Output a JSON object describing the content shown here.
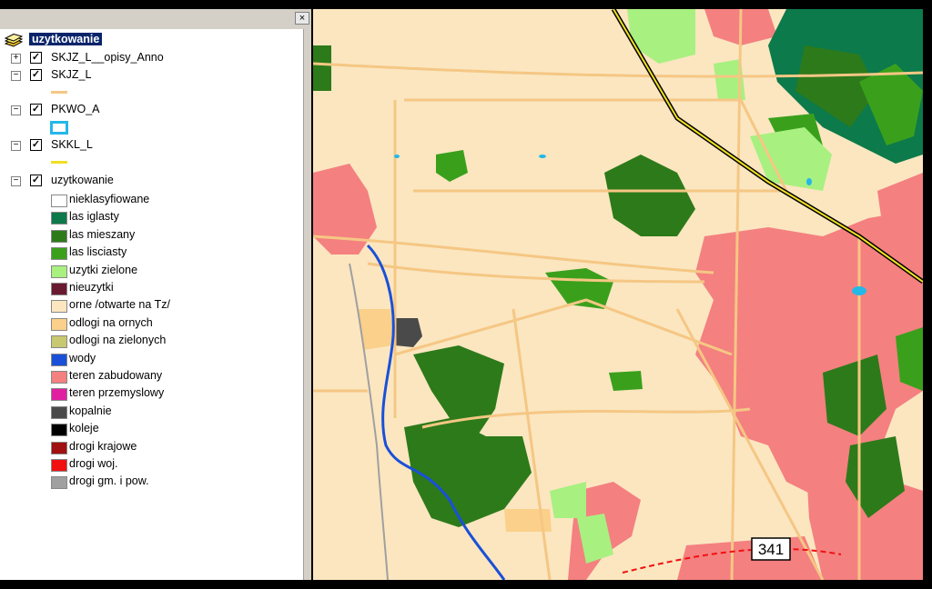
{
  "toc": {
    "close_glyph": "×",
    "root_layer": "uzytkowanie",
    "layers": [
      {
        "name": "SKJZ_L__opisy_Anno",
        "expander": "+",
        "checked": "✓"
      },
      {
        "name": "SKJZ_L",
        "expander": "−",
        "checked": "✓"
      },
      {
        "name": "PKWO_A",
        "expander": "−",
        "checked": "✓"
      },
      {
        "name": "SKKL_L",
        "expander": "−",
        "checked": "✓"
      },
      {
        "name": "uzytkowanie",
        "expander": "−",
        "checked": "✓"
      }
    ],
    "symbol_colors": {
      "SKJZ_L": "#f5c784",
      "PKWO_A": "#24b8e8",
      "SKKL_L": "#f0e020"
    },
    "legend": [
      {
        "label": "nieklasyfiowane",
        "color": "#ffffff"
      },
      {
        "label": "las iglasty",
        "color": "#0c7a4a"
      },
      {
        "label": "las mieszany",
        "color": "#2d7a1a"
      },
      {
        "label": "las lisciasty",
        "color": "#3aa01c"
      },
      {
        "label": "uzytki zielone",
        "color": "#a8f080"
      },
      {
        "label": "nieuzytki",
        "color": "#6a1a30"
      },
      {
        "label": "orne /otwarte na Tz/",
        "color": "#fbe6c0"
      },
      {
        "label": "odlogi na ornych",
        "color": "#fad08a"
      },
      {
        "label": "odlogi na zielonych",
        "color": "#c8c870"
      },
      {
        "label": "wody",
        "color": "#1a50d8"
      },
      {
        "label": "teren zabudowany",
        "color": "#f48080"
      },
      {
        "label": "teren przemyslowy",
        "color": "#e020a0"
      },
      {
        "label": "kopalnie",
        "color": "#4a4a4a"
      },
      {
        "label": "koleje",
        "color": "#000000"
      },
      {
        "label": "drogi krajowe",
        "color": "#a01010"
      },
      {
        "label": "drogi woj.",
        "color": "#f01010"
      },
      {
        "label": "drogi gm. i pow.",
        "color": "#a0a0a0"
      }
    ]
  },
  "map": {
    "road_label": "341"
  }
}
